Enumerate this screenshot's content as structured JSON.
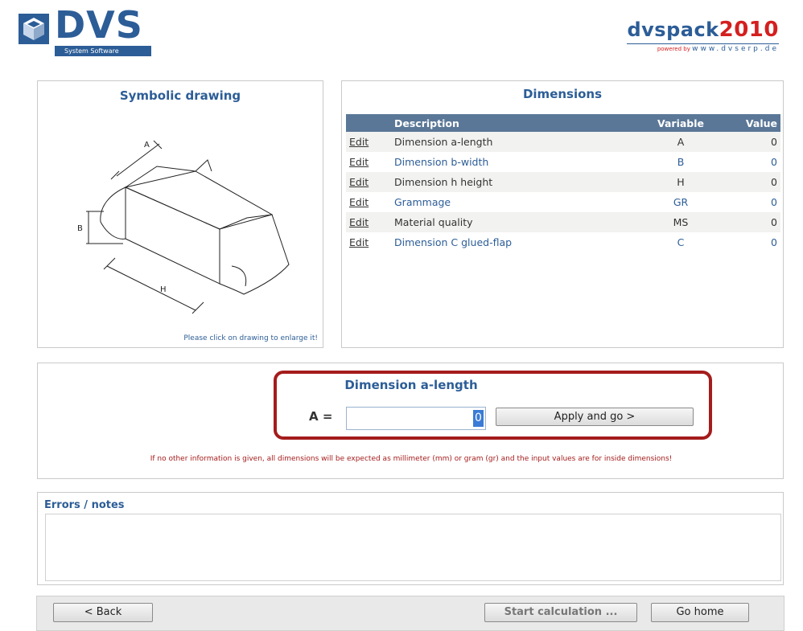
{
  "header": {
    "dvs_logo": "DVS",
    "dvs_subtitle": "System Software",
    "product_name": "dvspack",
    "product_year": "2010",
    "powered_by": "powered by",
    "website": "www.dvserp.de"
  },
  "drawing": {
    "title": "Symbolic drawing",
    "hint": "Please click on drawing to enlarge it!",
    "label_a": "A",
    "label_b": "B",
    "label_h": "H"
  },
  "dimensions": {
    "title": "Dimensions",
    "columns": {
      "edit": "",
      "description": "Description",
      "variable": "Variable",
      "value": "Value"
    },
    "rows": [
      {
        "edit": "Edit",
        "description": "Dimension a-length",
        "variable": "A",
        "value": "0"
      },
      {
        "edit": "Edit",
        "description": "Dimension b-width",
        "variable": "B",
        "value": "0"
      },
      {
        "edit": "Edit",
        "description": "Dimension h height",
        "variable": "H",
        "value": "0"
      },
      {
        "edit": "Edit",
        "description": "Grammage",
        "variable": "GR",
        "value": "0"
      },
      {
        "edit": "Edit",
        "description": "Material quality",
        "variable": "MS",
        "value": "0"
      },
      {
        "edit": "Edit",
        "description": "Dimension C glued-flap",
        "variable": "C",
        "value": "0"
      }
    ]
  },
  "input_section": {
    "title": "Dimension a-length",
    "variable_label": "A =",
    "value": "0",
    "apply_label": "Apply and go >",
    "note": "If no other information is given, all dimensions will be expected as millimeter (mm) or gram (gr) and the input values are for inside dimensions!"
  },
  "errors": {
    "label": "Errors / notes",
    "content": ""
  },
  "footer": {
    "back_label": "< Back",
    "start_label": "Start calculation ...",
    "home_label": "Go home"
  }
}
